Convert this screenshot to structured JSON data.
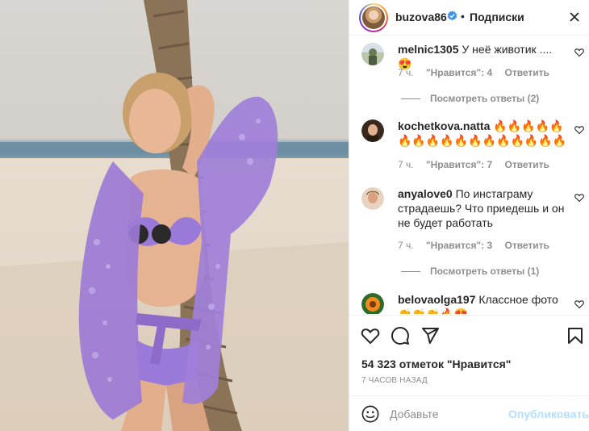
{
  "post": {
    "username": "buzova86",
    "follow_label": "Подписки",
    "dot": "•"
  },
  "comments": [
    {
      "username": "melnic1305",
      "text": "У неё животик .... 😍",
      "time": "7 ч.",
      "likes": "\"Нравится\": 4",
      "reply": "Ответить",
      "view_replies": "Посмотреть ответы (2)"
    },
    {
      "username": "kochetkova.natta",
      "text": "🔥🔥🔥🔥🔥🔥🔥🔥🔥🔥🔥🔥🔥🔥🔥🔥🔥",
      "time": "7 ч.",
      "likes": "\"Нравится\": 7",
      "reply": "Ответить"
    },
    {
      "username": "anyalove0",
      "text": "По инстаграму страдаешь? Что приедешь и он не будет работать",
      "time": "7 ч.",
      "likes": "\"Нравится\": 3",
      "reply": "Ответить",
      "view_replies": "Посмотреть ответы (1)"
    },
    {
      "username": "belovaolga197",
      "text": "Классное фото👏👏👏🔥😍"
    }
  ],
  "likes_count": "54 323 отметок \"Нравится\"",
  "timestamp": "7 ЧАСОВ НАЗАД",
  "add_comment": {
    "placeholder": "Добавьте",
    "publish_label": "Опубликовать"
  },
  "icons": [
    "verified-icon",
    "more-icon",
    "heart-icon",
    "comment-icon",
    "share-icon",
    "bookmark-icon",
    "emoji-icon"
  ],
  "colors": {
    "accent_disabled": "#b2dffc",
    "muted": "#8e8e8e",
    "verified": "#3897f0"
  }
}
